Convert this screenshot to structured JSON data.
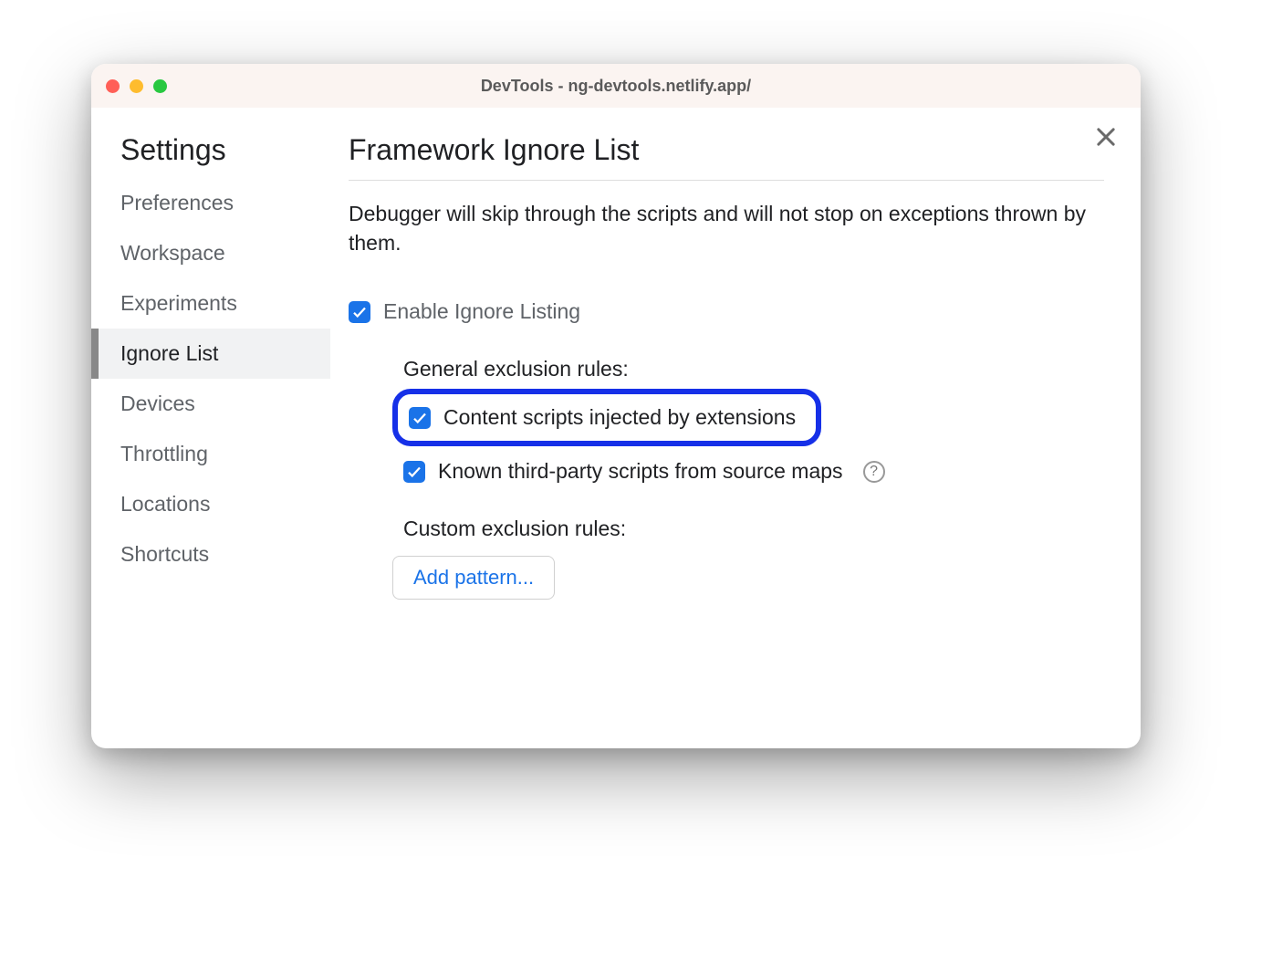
{
  "window": {
    "title": "DevTools - ng-devtools.netlify.app/"
  },
  "sidebar": {
    "title": "Settings",
    "items": [
      {
        "label": "Preferences",
        "active": false
      },
      {
        "label": "Workspace",
        "active": false
      },
      {
        "label": "Experiments",
        "active": false
      },
      {
        "label": "Ignore List",
        "active": true
      },
      {
        "label": "Devices",
        "active": false
      },
      {
        "label": "Throttling",
        "active": false
      },
      {
        "label": "Locations",
        "active": false
      },
      {
        "label": "Shortcuts",
        "active": false
      }
    ]
  },
  "main": {
    "title": "Framework Ignore List",
    "description": "Debugger will skip through the scripts and will not stop on exceptions thrown by them.",
    "enable_label": "Enable Ignore Listing",
    "enable_checked": true,
    "general_rules_label": "General exclusion rules:",
    "rules": [
      {
        "label": "Content scripts injected by extensions",
        "checked": true,
        "highlighted": true,
        "help": false
      },
      {
        "label": "Known third-party scripts from source maps",
        "checked": true,
        "highlighted": false,
        "help": true
      }
    ],
    "custom_rules_label": "Custom exclusion rules:",
    "add_pattern_label": "Add pattern..."
  }
}
